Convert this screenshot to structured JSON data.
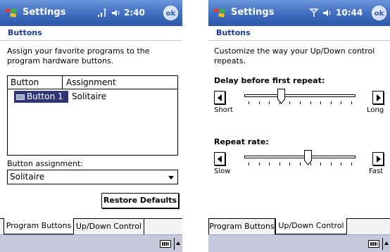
{
  "left": {
    "app_title": "Settings",
    "time": "2:40",
    "ok_label": "ok",
    "page_header": "Buttons",
    "description": "Assign your favorite programs to the program hardware buttons.",
    "table": {
      "headers": [
        "Button",
        "Assignment"
      ],
      "rows": [
        {
          "button": "Button 1",
          "assignment": "Solitaire"
        }
      ]
    },
    "assignment_label": "Button assignment:",
    "assignment_value": "Solitaire",
    "restore_label": "Restore Defaults",
    "tabs": [
      {
        "label": "Program Buttons",
        "active": true
      },
      {
        "label": "Up/Down Control",
        "active": false
      }
    ]
  },
  "right": {
    "app_title": "Settings",
    "time": "10:44",
    "ok_label": "ok",
    "page_header": "Buttons",
    "description": "Customize the way your Up/Down control repeats.",
    "delay": {
      "label": "Delay before first repeat:",
      "min_label": "Short",
      "max_label": "Long",
      "level": 0.33
    },
    "rate": {
      "label": "Repeat rate:",
      "min_label": "Slow",
      "max_label": "Fast",
      "level": 0.57
    },
    "tabs": [
      {
        "label": "Program Buttons",
        "active": false
      },
      {
        "label": "Up/Down Control",
        "active": true
      }
    ]
  }
}
